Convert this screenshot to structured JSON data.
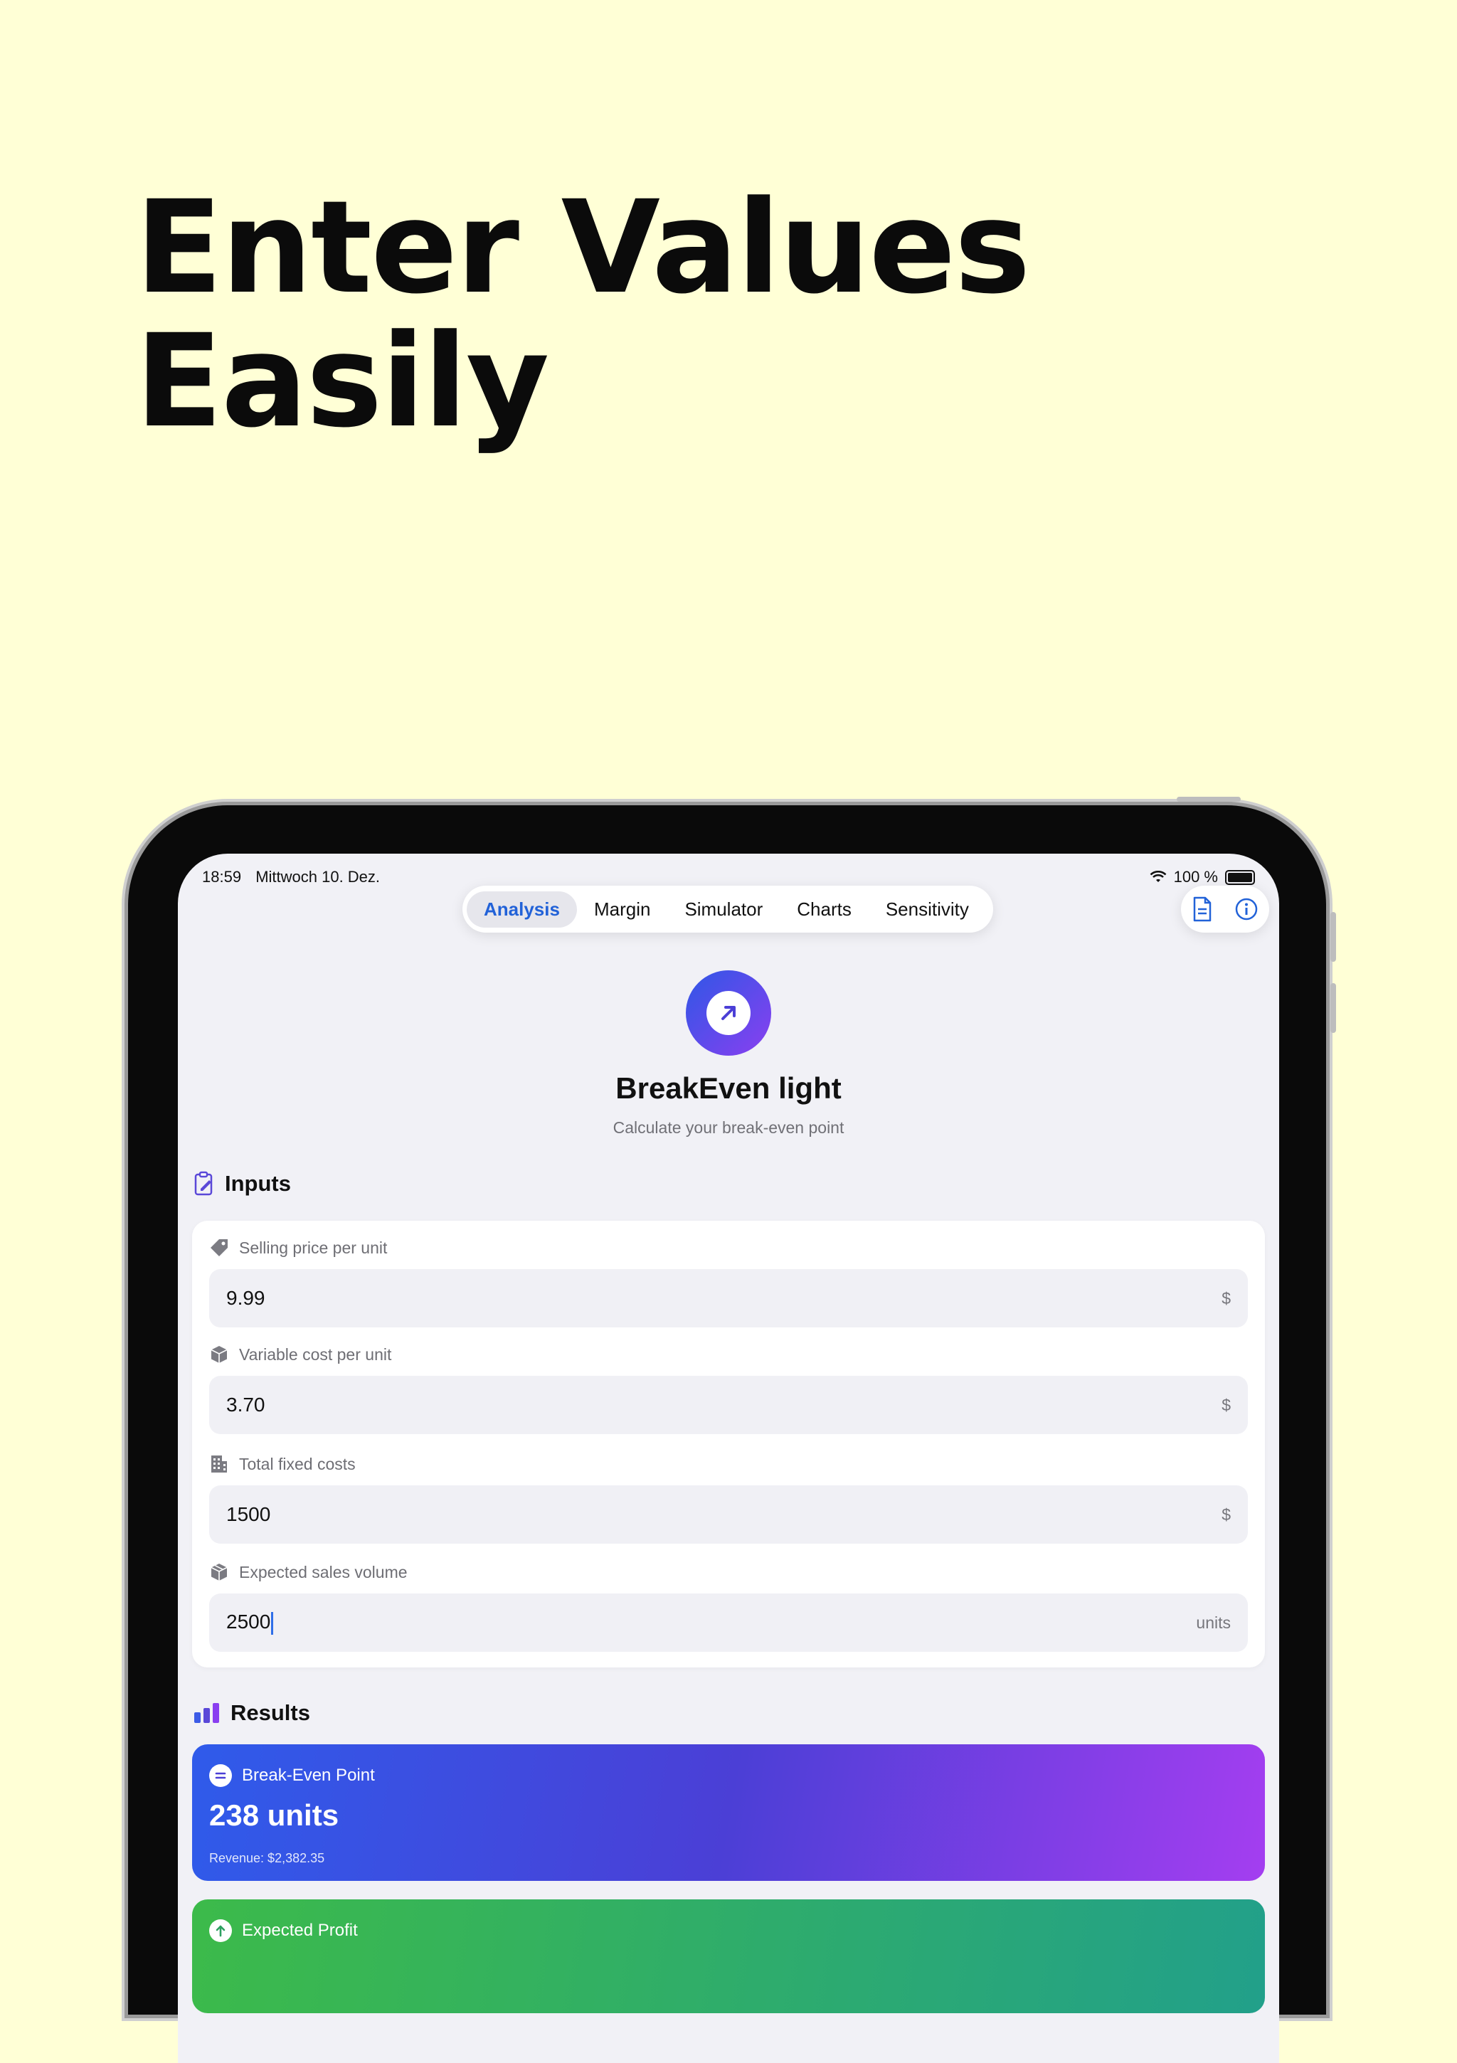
{
  "headline": {
    "line1": "Enter Values",
    "line2": "Easily"
  },
  "status_bar": {
    "time": "18:59",
    "date": "Mittwoch 10. Dez.",
    "battery": "100 %"
  },
  "tabs": [
    {
      "label": "Analysis",
      "active": true
    },
    {
      "label": "Margin"
    },
    {
      "label": "Simulator"
    },
    {
      "label": "Charts"
    },
    {
      "label": "Sensitivity"
    }
  ],
  "app": {
    "title": "BreakEven light",
    "subtitle": "Calculate your break-even point"
  },
  "inputs": {
    "section_title": "Inputs",
    "fields": [
      {
        "label": "Selling price per unit",
        "value": "9.99",
        "unit": "$",
        "icon": "tag-icon"
      },
      {
        "label": "Variable cost per unit",
        "value": "3.70",
        "unit": "$",
        "icon": "box-icon"
      },
      {
        "label": "Total fixed costs",
        "value": "1500",
        "unit": "$",
        "icon": "building-icon"
      },
      {
        "label": "Expected sales volume",
        "value": "2500",
        "unit": "units",
        "icon": "boxes-icon"
      }
    ]
  },
  "results": {
    "section_title": "Results",
    "break_even": {
      "label": "Break-Even Point",
      "value": "238 units",
      "sub": "Revenue: $2,382.35"
    },
    "profit": {
      "label": "Expected Profit"
    }
  },
  "colors": {
    "accent": "#2262d8",
    "background": "#ffffd6",
    "gradient_start": "#2f5bea",
    "gradient_end": "#a43ef0",
    "profit_green": "#3cba4a"
  }
}
